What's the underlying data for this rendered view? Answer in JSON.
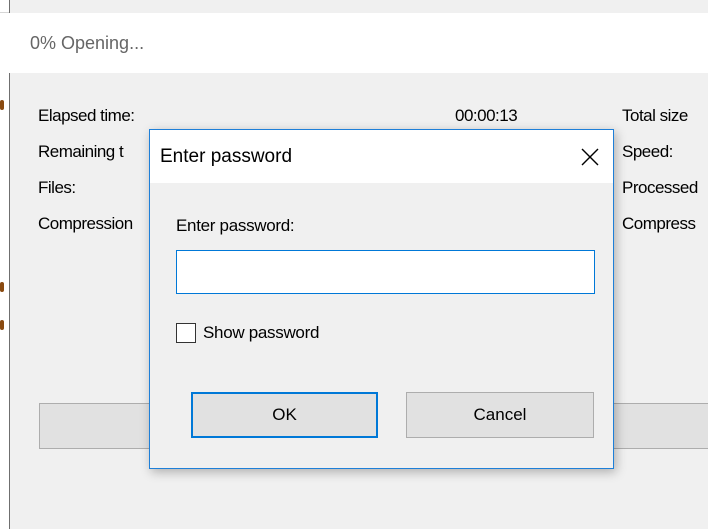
{
  "background_window": {
    "title": "0% Opening...",
    "left_labels": [
      "Elapsed time:",
      "Remaining t",
      "Files:",
      "Compression"
    ],
    "elapsed_value": "00:00:13",
    "right_labels": [
      "Total size",
      "Speed:",
      "Processed",
      "Compress"
    ]
  },
  "dialog": {
    "title": "Enter password",
    "close_glyph": "close-icon",
    "prompt_label": "Enter password:",
    "password_value": "",
    "show_password_label": "Show password",
    "show_password_checked": false,
    "ok_label": "OK",
    "cancel_label": "Cancel"
  },
  "colors": {
    "accent": "#0078d7",
    "dialog_border": "#1e7fd8",
    "window_bg": "#f0f0f0",
    "button_bg": "#e1e1e1"
  }
}
